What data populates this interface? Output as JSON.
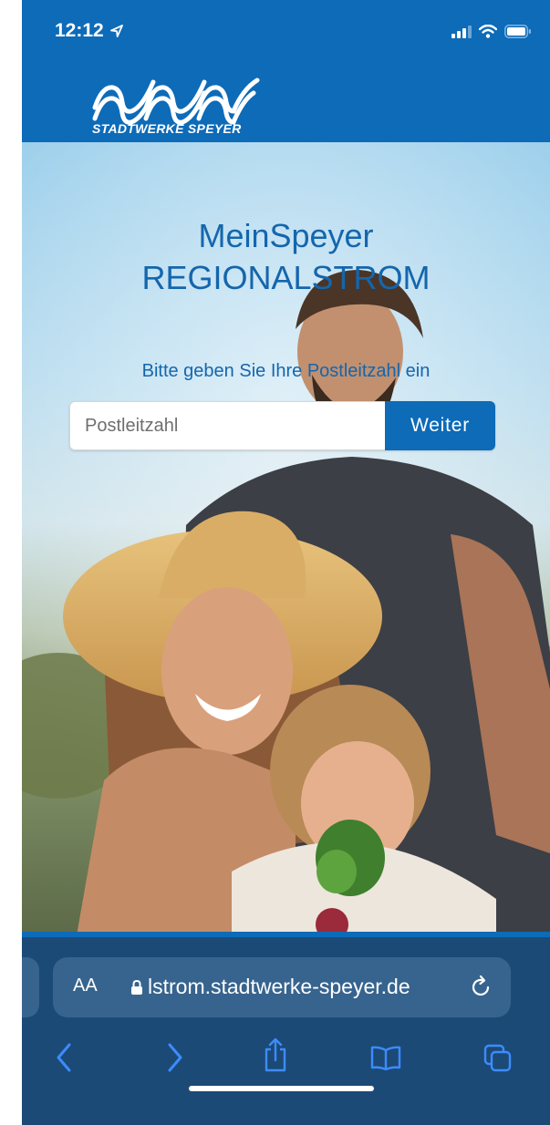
{
  "status_bar": {
    "time": "12:12"
  },
  "brand": {
    "caption": "STADTWERKE SPEYER"
  },
  "hero": {
    "title_line1": "MeinSpeyer",
    "title_line2": "REGIONALSTROM",
    "prompt": "Bitte geben Sie Ihre Postleitzahl ein"
  },
  "form": {
    "postcode_placeholder": "Postleitzahl",
    "postcode_value": "",
    "submit_label": "Weiter"
  },
  "browser": {
    "text_size_label": "AA",
    "url": "lstrom.stadtwerke-speyer.de"
  },
  "colors": {
    "brand_blue": "#0d6bb8",
    "title_blue": "#1466ad",
    "toolbar": "#1c4a76",
    "toolbar_icon": "#3c8cff"
  },
  "icons": {
    "status": [
      "location-arrow-icon",
      "signal-icon",
      "wifi-icon",
      "battery-icon"
    ],
    "toolbar": [
      "back-icon",
      "forward-icon",
      "share-icon",
      "bookmarks-icon",
      "tabs-icon"
    ]
  }
}
